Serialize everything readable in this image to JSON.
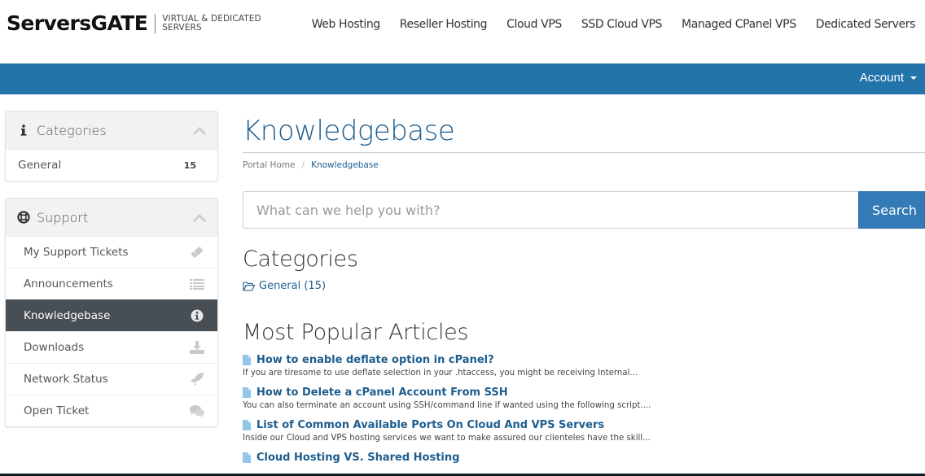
{
  "brand": {
    "name": "ServersGATE",
    "tagline_line1": "VIRTUAL & DEDICATED",
    "tagline_line2": "SERVERS"
  },
  "main_nav": [
    {
      "label": "Web Hosting"
    },
    {
      "label": "Reseller Hosting"
    },
    {
      "label": "Cloud VPS"
    },
    {
      "label": "SSD Cloud VPS"
    },
    {
      "label": "Managed CPanel VPS"
    },
    {
      "label": "Dedicated Servers"
    }
  ],
  "account_menu": {
    "label": "Account"
  },
  "colors": {
    "brand_blue": "#2474ac",
    "link_blue": "#1d5e90",
    "active_item": "#474e54"
  },
  "sidebar": {
    "categories_panel": {
      "title": "Categories",
      "icon": "info-icon",
      "items": [
        {
          "label": "General",
          "count": "15"
        }
      ]
    },
    "support_panel": {
      "title": "Support",
      "icon": "life-ring-icon",
      "items": [
        {
          "label": "My Support Tickets",
          "icon": "ticket-icon"
        },
        {
          "label": "Announcements",
          "icon": "list-icon"
        },
        {
          "label": "Knowledgebase",
          "icon": "info-circle-icon",
          "active": true
        },
        {
          "label": "Downloads",
          "icon": "download-icon"
        },
        {
          "label": "Network Status",
          "icon": "rocket-icon"
        },
        {
          "label": "Open Ticket",
          "icon": "comments-icon"
        }
      ]
    }
  },
  "page": {
    "title": "Knowledgebase",
    "breadcrumb": [
      {
        "label": "Portal Home"
      },
      {
        "label": "Knowledgebase"
      }
    ],
    "breadcrumb_separator": "/",
    "search": {
      "placeholder": "What can we help you with?",
      "button_label": "Search"
    },
    "categories_heading": "Categories",
    "categories": [
      {
        "label": "General (15)",
        "icon": "folder-open-icon"
      }
    ],
    "popular_heading": "Most Popular Articles",
    "articles": [
      {
        "title": "How to enable deflate option in cPanel?",
        "excerpt": "If you are tiresome to use deflate selection in your .htaccess, you might be receiving Internal..."
      },
      {
        "title": "How to Delete a cPanel Account From SSH",
        "excerpt": "You can also terminate an account using SSH/command line if wanted using the following script...."
      },
      {
        "title": "List of Common Available Ports On Cloud And VPS Servers",
        "excerpt": "Inside our Cloud and VPS hosting services we want to make assured our clienteles have the skill..."
      },
      {
        "title": "Cloud Hosting VS. Shared Hosting",
        "excerpt": ""
      }
    ]
  }
}
